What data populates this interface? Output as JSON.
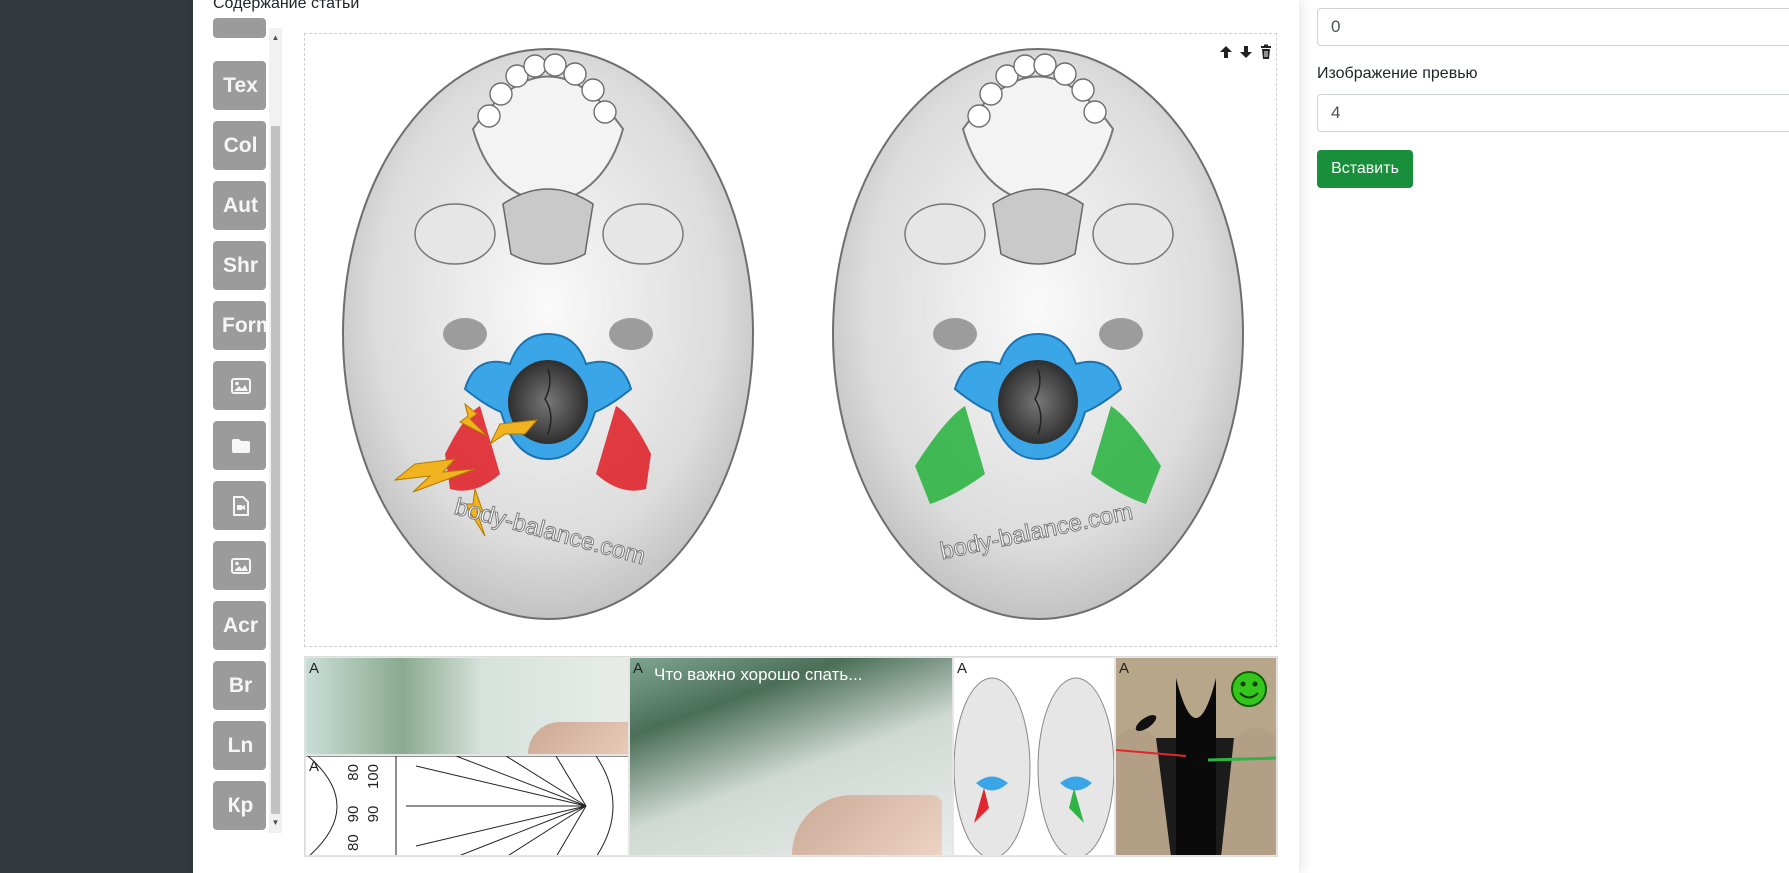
{
  "editor": {
    "section_label": "Содержание статьи",
    "toolbar": [
      {
        "label": "Tex",
        "icon": ""
      },
      {
        "label": "Col",
        "icon": ""
      },
      {
        "label": "Aut",
        "icon": ""
      },
      {
        "label": "Shr",
        "icon": ""
      },
      {
        "label": "Form",
        "icon": ""
      },
      {
        "label": "",
        "icon": "image-icon"
      },
      {
        "label": "",
        "icon": "folder-icon"
      },
      {
        "label": "",
        "icon": "video-file-icon"
      },
      {
        "label": "",
        "icon": "image-icon"
      },
      {
        "label": "Acr",
        "icon": ""
      },
      {
        "label": "Br",
        "icon": ""
      },
      {
        "label": "Ln",
        "icon": ""
      },
      {
        "label": "Кр",
        "icon": ""
      }
    ],
    "main_image": {
      "watermark_left": "body-balance.com",
      "watermark_right": "body-balance.com",
      "controls": [
        "arrow-up-icon",
        "arrow-down-icon",
        "trash-icon"
      ]
    },
    "thumbnails": [
      {
        "badge": "A",
        "title": ""
      },
      {
        "badge": "A",
        "title": "Что важно хорошо спать..."
      },
      {
        "badge": "A",
        "title": ""
      },
      {
        "badge": "A",
        "title": ""
      },
      {
        "badge": "A",
        "title": "",
        "scale_labels": [
          "80",
          "90",
          "100",
          "90",
          "80"
        ]
      }
    ]
  },
  "form": {
    "field_top_value": "0",
    "preview_label": "Изображение превью",
    "preview_value": "4",
    "insert_button": "Вставить"
  },
  "colors": {
    "sidebar": "#343a40",
    "tool_button": "#9b9b9b",
    "insert_button": "#198f3b",
    "atlas_blue": "#3aa6e8",
    "muscle_red": "#e0262e",
    "muscle_green": "#2fb545",
    "bolt_yellow": "#f2b320"
  }
}
